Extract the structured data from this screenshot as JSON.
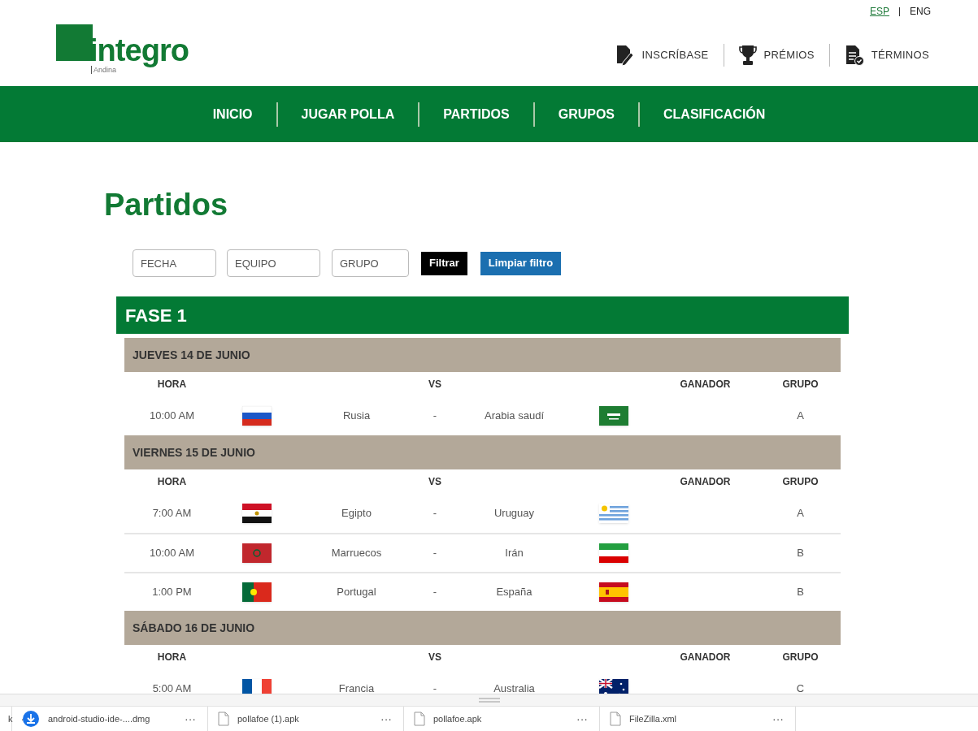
{
  "languages": [
    {
      "label": "ESP",
      "selected": true
    },
    {
      "label": "ENG",
      "selected": false
    }
  ],
  "logo": {
    "name": "integro",
    "tagline": "Andina"
  },
  "header_links": [
    {
      "label": "INSCRÍBASE",
      "kind": "signup"
    },
    {
      "label": "PRÉMIOS",
      "kind": "trophy"
    },
    {
      "label": "TÉRMINOS",
      "kind": "terms"
    }
  ],
  "nav": [
    "INICIO",
    "JUGAR POLLA",
    "PARTIDOS",
    "GRUPOS",
    "CLASIFICACIÓN"
  ],
  "page_title": "Partidos",
  "filters": {
    "fields": [
      {
        "placeholder": "FECHA"
      },
      {
        "placeholder": "EQUIPO"
      },
      {
        "placeholder": "GRUPO"
      }
    ],
    "filter_button": "Filtrar",
    "clear_button": "Limpiar filtro"
  },
  "phase": "FASE 1",
  "days": [
    {
      "date": "JUEVES 14 DE JUNIO",
      "columns": {
        "hora": "HORA",
        "vs": "VS",
        "ganador": "GANADOR",
        "grupo": "GRUPO"
      },
      "matches": [
        {
          "time": "10:00 AM",
          "home": "Rusia",
          "home_flag": {
            "kind": "russia"
          },
          "dash": "-",
          "away": "Arabia saudí",
          "away_flag": {
            "kind": "saudi"
          },
          "group": "A"
        }
      ]
    },
    {
      "date": "VIERNES 15 DE JUNIO",
      "columns": {
        "hora": "HORA",
        "vs": "VS",
        "ganador": "GANADOR",
        "grupo": "GRUPO"
      },
      "matches": [
        {
          "time": "7:00 AM",
          "home": "Egipto",
          "home_flag": {
            "kind": "egypt"
          },
          "dash": "-",
          "away": "Uruguay",
          "away_flag": {
            "kind": "uruguay"
          },
          "group": "A"
        },
        {
          "time": "10:00 AM",
          "home": "Marruecos",
          "home_flag": {
            "kind": "morocco"
          },
          "dash": "-",
          "away": "Irán",
          "away_flag": {
            "kind": "iran"
          },
          "group": "B"
        },
        {
          "time": "1:00 PM",
          "home": "Portugal",
          "home_flag": {
            "kind": "portugal"
          },
          "dash": "-",
          "away": "España",
          "away_flag": {
            "kind": "spain"
          },
          "group": "B"
        }
      ]
    },
    {
      "date": "SÁBADO 16 DE JUNIO",
      "columns": {
        "hora": "HORA",
        "vs": "VS",
        "ganador": "GANADOR",
        "grupo": "GRUPO"
      },
      "matches": [
        {
          "time": "5:00 AM",
          "home": "Francia",
          "home_flag": {
            "kind": "france"
          },
          "dash": "-",
          "away": "Australia",
          "away_flag": {
            "kind": "australia"
          },
          "group": "C"
        }
      ]
    }
  ],
  "downloads": [
    {
      "name": "k",
      "kind": "file"
    },
    {
      "name": "android-studio-ide-....dmg",
      "kind": "downloading"
    },
    {
      "name": "pollafoe (1).apk",
      "kind": "file"
    },
    {
      "name": "pollafoe.apk",
      "kind": "file"
    },
    {
      "name": "FileZilla.xml",
      "kind": "file"
    }
  ],
  "download_more": "···"
}
